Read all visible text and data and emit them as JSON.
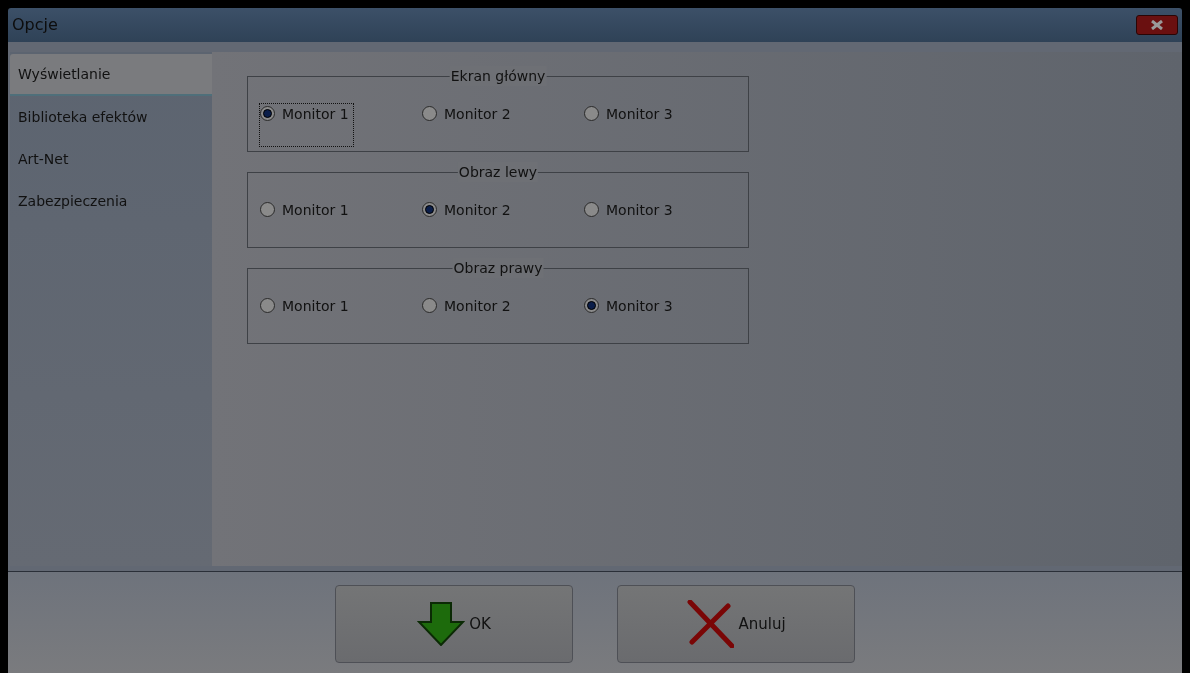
{
  "window": {
    "title": "Opcje"
  },
  "tabs": [
    {
      "label": "Wyświetlanie",
      "selected": true
    },
    {
      "label": "Biblioteka efektów",
      "selected": false
    },
    {
      "label": "Art-Net",
      "selected": false
    },
    {
      "label": "Zabezpieczenia",
      "selected": false
    }
  ],
  "groups": [
    {
      "title": "Ekran główny",
      "options": [
        {
          "label": "Monitor 1",
          "selected": true,
          "focused": true
        },
        {
          "label": "Monitor 2",
          "selected": false,
          "focused": false
        },
        {
          "label": "Monitor 3",
          "selected": false,
          "focused": false
        }
      ]
    },
    {
      "title": "Obraz lewy",
      "options": [
        {
          "label": "Monitor 1",
          "selected": false,
          "focused": false
        },
        {
          "label": "Monitor 2",
          "selected": true,
          "focused": false
        },
        {
          "label": "Monitor 3",
          "selected": false,
          "focused": false
        }
      ]
    },
    {
      "title": "Obraz prawy",
      "options": [
        {
          "label": "Monitor 1",
          "selected": false,
          "focused": false
        },
        {
          "label": "Monitor 2",
          "selected": false,
          "focused": false
        },
        {
          "label": "Monitor 3",
          "selected": true,
          "focused": false
        }
      ]
    }
  ],
  "buttons": [
    {
      "label": "OK",
      "kind": "ok"
    },
    {
      "label": "Anuluj",
      "kind": "cancel"
    }
  ]
}
